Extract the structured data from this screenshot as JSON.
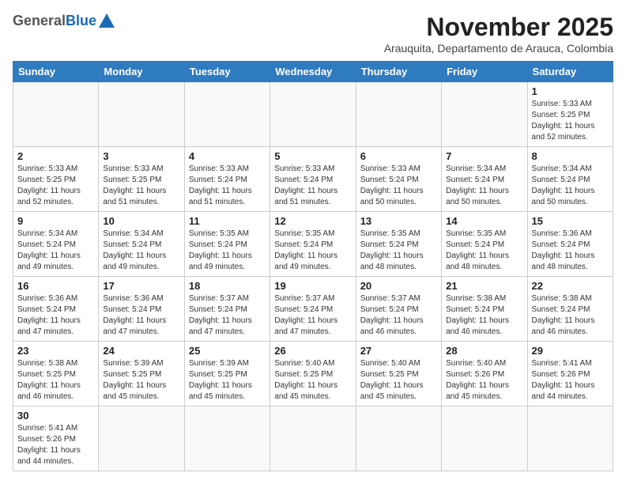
{
  "header": {
    "logo_general": "General",
    "logo_blue": "Blue",
    "month_title": "November 2025",
    "subtitle": "Arauquita, Departamento de Arauca, Colombia"
  },
  "weekdays": [
    "Sunday",
    "Monday",
    "Tuesday",
    "Wednesday",
    "Thursday",
    "Friday",
    "Saturday"
  ],
  "weeks": [
    [
      {
        "day": "",
        "info": ""
      },
      {
        "day": "",
        "info": ""
      },
      {
        "day": "",
        "info": ""
      },
      {
        "day": "",
        "info": ""
      },
      {
        "day": "",
        "info": ""
      },
      {
        "day": "",
        "info": ""
      },
      {
        "day": "1",
        "info": "Sunrise: 5:33 AM\nSunset: 5:25 PM\nDaylight: 11 hours\nand 52 minutes."
      }
    ],
    [
      {
        "day": "2",
        "info": "Sunrise: 5:33 AM\nSunset: 5:25 PM\nDaylight: 11 hours\nand 52 minutes."
      },
      {
        "day": "3",
        "info": "Sunrise: 5:33 AM\nSunset: 5:25 PM\nDaylight: 11 hours\nand 51 minutes."
      },
      {
        "day": "4",
        "info": "Sunrise: 5:33 AM\nSunset: 5:24 PM\nDaylight: 11 hours\nand 51 minutes."
      },
      {
        "day": "5",
        "info": "Sunrise: 5:33 AM\nSunset: 5:24 PM\nDaylight: 11 hours\nand 51 minutes."
      },
      {
        "day": "6",
        "info": "Sunrise: 5:33 AM\nSunset: 5:24 PM\nDaylight: 11 hours\nand 50 minutes."
      },
      {
        "day": "7",
        "info": "Sunrise: 5:34 AM\nSunset: 5:24 PM\nDaylight: 11 hours\nand 50 minutes."
      },
      {
        "day": "8",
        "info": "Sunrise: 5:34 AM\nSunset: 5:24 PM\nDaylight: 11 hours\nand 50 minutes."
      }
    ],
    [
      {
        "day": "9",
        "info": "Sunrise: 5:34 AM\nSunset: 5:24 PM\nDaylight: 11 hours\nand 49 minutes."
      },
      {
        "day": "10",
        "info": "Sunrise: 5:34 AM\nSunset: 5:24 PM\nDaylight: 11 hours\nand 49 minutes."
      },
      {
        "day": "11",
        "info": "Sunrise: 5:35 AM\nSunset: 5:24 PM\nDaylight: 11 hours\nand 49 minutes."
      },
      {
        "day": "12",
        "info": "Sunrise: 5:35 AM\nSunset: 5:24 PM\nDaylight: 11 hours\nand 49 minutes."
      },
      {
        "day": "13",
        "info": "Sunrise: 5:35 AM\nSunset: 5:24 PM\nDaylight: 11 hours\nand 48 minutes."
      },
      {
        "day": "14",
        "info": "Sunrise: 5:35 AM\nSunset: 5:24 PM\nDaylight: 11 hours\nand 48 minutes."
      },
      {
        "day": "15",
        "info": "Sunrise: 5:36 AM\nSunset: 5:24 PM\nDaylight: 11 hours\nand 48 minutes."
      }
    ],
    [
      {
        "day": "16",
        "info": "Sunrise: 5:36 AM\nSunset: 5:24 PM\nDaylight: 11 hours\nand 47 minutes."
      },
      {
        "day": "17",
        "info": "Sunrise: 5:36 AM\nSunset: 5:24 PM\nDaylight: 11 hours\nand 47 minutes."
      },
      {
        "day": "18",
        "info": "Sunrise: 5:37 AM\nSunset: 5:24 PM\nDaylight: 11 hours\nand 47 minutes."
      },
      {
        "day": "19",
        "info": "Sunrise: 5:37 AM\nSunset: 5:24 PM\nDaylight: 11 hours\nand 47 minutes."
      },
      {
        "day": "20",
        "info": "Sunrise: 5:37 AM\nSunset: 5:24 PM\nDaylight: 11 hours\nand 46 minutes."
      },
      {
        "day": "21",
        "info": "Sunrise: 5:38 AM\nSunset: 5:24 PM\nDaylight: 11 hours\nand 46 minutes."
      },
      {
        "day": "22",
        "info": "Sunrise: 5:38 AM\nSunset: 5:24 PM\nDaylight: 11 hours\nand 46 minutes."
      }
    ],
    [
      {
        "day": "23",
        "info": "Sunrise: 5:38 AM\nSunset: 5:25 PM\nDaylight: 11 hours\nand 46 minutes."
      },
      {
        "day": "24",
        "info": "Sunrise: 5:39 AM\nSunset: 5:25 PM\nDaylight: 11 hours\nand 45 minutes."
      },
      {
        "day": "25",
        "info": "Sunrise: 5:39 AM\nSunset: 5:25 PM\nDaylight: 11 hours\nand 45 minutes."
      },
      {
        "day": "26",
        "info": "Sunrise: 5:40 AM\nSunset: 5:25 PM\nDaylight: 11 hours\nand 45 minutes."
      },
      {
        "day": "27",
        "info": "Sunrise: 5:40 AM\nSunset: 5:25 PM\nDaylight: 11 hours\nand 45 minutes."
      },
      {
        "day": "28",
        "info": "Sunrise: 5:40 AM\nSunset: 5:26 PM\nDaylight: 11 hours\nand 45 minutes."
      },
      {
        "day": "29",
        "info": "Sunrise: 5:41 AM\nSunset: 5:26 PM\nDaylight: 11 hours\nand 44 minutes."
      }
    ],
    [
      {
        "day": "30",
        "info": "Sunrise: 5:41 AM\nSunset: 5:26 PM\nDaylight: 11 hours\nand 44 minutes."
      },
      {
        "day": "",
        "info": ""
      },
      {
        "day": "",
        "info": ""
      },
      {
        "day": "",
        "info": ""
      },
      {
        "day": "",
        "info": ""
      },
      {
        "day": "",
        "info": ""
      },
      {
        "day": "",
        "info": ""
      }
    ]
  ]
}
